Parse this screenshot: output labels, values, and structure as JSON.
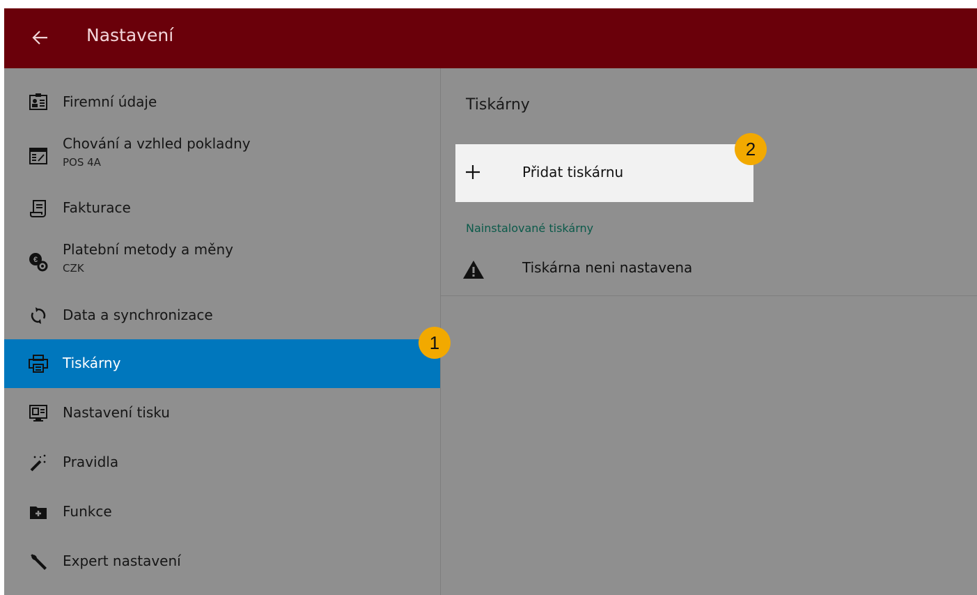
{
  "appbar": {
    "title": "Nastavení",
    "back_icon": "arrow-left-icon"
  },
  "sidebar": {
    "items": [
      {
        "label": "Firemní údaje",
        "icon": "company-card-icon"
      },
      {
        "label": "Chování a vzhled pokladny",
        "sub": "POS 4A",
        "icon": "pos-screen-icon"
      },
      {
        "label": "Fakturace",
        "icon": "invoice-icon"
      },
      {
        "label": "Platební metody a měny",
        "sub": "CZK",
        "icon": "payment-methods-icon"
      },
      {
        "label": "Data a synchronizace",
        "icon": "sync-icon"
      },
      {
        "label": "Tiskárny",
        "icon": "printer-icon",
        "active": true
      },
      {
        "label": "Nastavení tisku",
        "icon": "print-settings-icon"
      },
      {
        "label": "Pravidla",
        "icon": "magic-wand-icon"
      },
      {
        "label": "Funkce",
        "icon": "folder-plus-icon"
      },
      {
        "label": "Expert nastavení",
        "icon": "wrench-icon"
      }
    ]
  },
  "content": {
    "title": "Tiskárny",
    "add_button": {
      "label": "Přidat tiskárnu",
      "icon": "plus-icon"
    },
    "installed_header": "Nainstalované tiskárny",
    "printers": [
      {
        "label": "Tiskárna neni nastavena",
        "icon": "warning-icon"
      }
    ]
  },
  "annotations": {
    "badge_1": "1",
    "badge_2": "2"
  },
  "colors": {
    "appbar": "#6a000a",
    "active": "#0077bd",
    "badge": "#f2a900",
    "subheader": "#0b5a4a"
  }
}
